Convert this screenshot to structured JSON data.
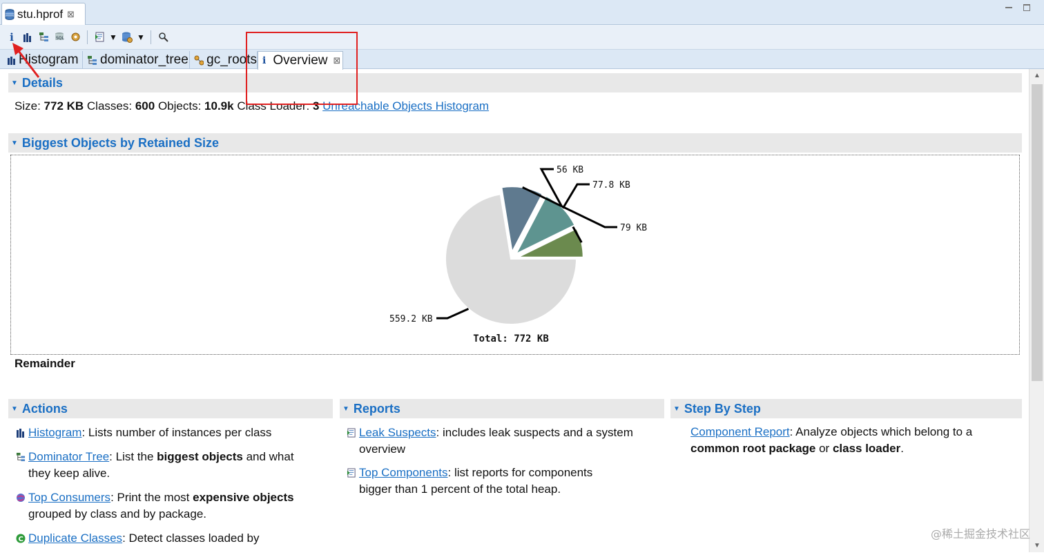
{
  "editor": {
    "tab_title": "stu.hprof",
    "close_glyph": "⊠"
  },
  "toolbar": {
    "info_glyph": "i"
  },
  "view_tabs": [
    {
      "label": "Histogram",
      "icon": "histogram-icon"
    },
    {
      "label": "dominator_tree",
      "icon": "dominator-tree-icon"
    },
    {
      "label": "gc_roots",
      "icon": "gc-roots-icon"
    },
    {
      "label": "Overview",
      "icon": "info-icon",
      "active": true
    }
  ],
  "details": {
    "title": "Details",
    "size_label": "Size:",
    "size_value": "772 KB",
    "classes_label": "Classes:",
    "classes_value": "600",
    "objects_label": "Objects:",
    "objects_value": "10.9k",
    "loader_label": "Class Loader:",
    "loader_value": "3",
    "link": "Unreachable Objects Histogram"
  },
  "biggest": {
    "title": "Biggest Objects by Retained Size",
    "remainder": "Remainder"
  },
  "chart_data": {
    "type": "pie",
    "unit": "KB",
    "slices": [
      {
        "label": "56 KB",
        "value": 56,
        "color": "#6b8a4e"
      },
      {
        "label": "77.8 KB",
        "value": 77.8,
        "color": "#5e9490"
      },
      {
        "label": "79 KB",
        "value": 79,
        "color": "#5f7a8f"
      },
      {
        "label": "559.2 KB",
        "value": 559.2,
        "color": "#dcdcdc"
      }
    ],
    "total_label": "Total: 772 KB"
  },
  "actions": {
    "title": "Actions",
    "items": [
      {
        "link": "Histogram",
        "pre": ": Lists number of instances per class"
      },
      {
        "link": "Dominator Tree",
        "pre": ": List the ",
        "b1": "biggest objects",
        "post": " and what",
        "line2": "they keep alive."
      },
      {
        "link": "Top Consumers",
        "pre": ": Print the most ",
        "b1": "expensive objects",
        "line2": "grouped by class and by package."
      },
      {
        "link": "Duplicate Classes",
        "pre": ": Detect classes loaded by"
      }
    ]
  },
  "reports": {
    "title": "Reports",
    "items": [
      {
        "link": "Leak Suspects",
        "pre": ": includes leak suspects and a system",
        "line2": "overview"
      },
      {
        "link": "Top Components",
        "pre": ": list reports for components",
        "line2": "bigger than 1 percent of the total heap."
      }
    ]
  },
  "steps": {
    "title": "Step By Step",
    "link": "Component Report",
    "pre": ": Analyze objects which belong to a",
    "b1": "common root package",
    "mid": " or ",
    "b2": "class loader",
    "end": "."
  },
  "watermark": "@稀土掘金技术社区",
  "colors": {
    "accent": "#1a6fc4",
    "annotation": "#e02020"
  }
}
